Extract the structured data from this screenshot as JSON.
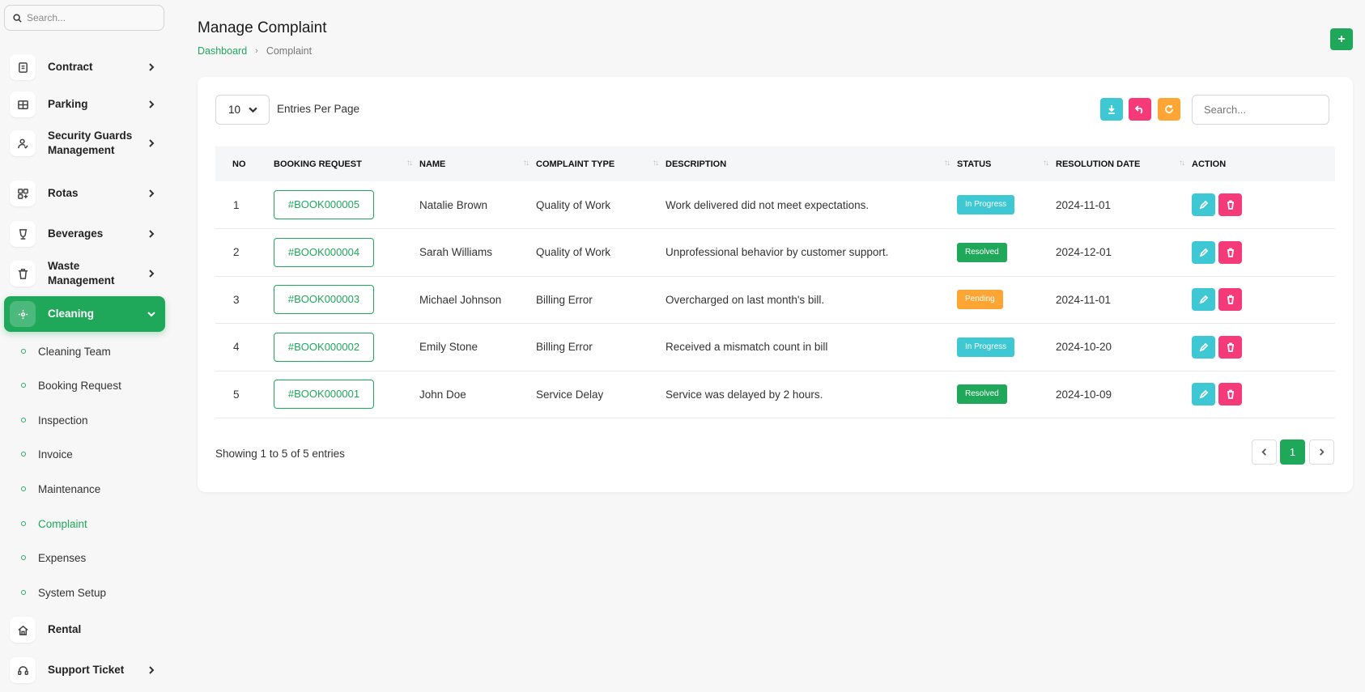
{
  "sidebar": {
    "search_placeholder": "Search...",
    "items": [
      {
        "label": "Contract",
        "icon": "contract-icon"
      },
      {
        "label": "Parking",
        "icon": "parking-icon"
      },
      {
        "label": "Security Guards Management",
        "icon": "security-guard-icon"
      },
      {
        "label": "Rotas",
        "icon": "rotas-icon"
      },
      {
        "label": "Beverages",
        "icon": "beverages-icon"
      },
      {
        "label": "Waste Management",
        "icon": "trash-icon"
      },
      {
        "label": "Cleaning",
        "icon": "sparkle-icon",
        "active": true
      }
    ],
    "sub_items": [
      {
        "label": "Cleaning Team"
      },
      {
        "label": "Booking Request"
      },
      {
        "label": "Inspection"
      },
      {
        "label": "Invoice"
      },
      {
        "label": "Maintenance"
      },
      {
        "label": "Complaint",
        "active": true
      },
      {
        "label": "Expenses"
      },
      {
        "label": "System Setup"
      }
    ],
    "bottom_items": [
      {
        "label": "Rental",
        "icon": "home-icon"
      },
      {
        "label": "Support Ticket",
        "icon": "headset-icon"
      }
    ]
  },
  "header": {
    "title": "Manage Complaint",
    "breadcrumb": [
      "Dashboard",
      "Complaint"
    ],
    "add_label": "+"
  },
  "table_controls": {
    "per_page_value": "10",
    "per_page_label": "Entries Per Page",
    "search_placeholder": "Search..."
  },
  "table": {
    "columns": [
      "NO",
      "BOOKING REQUEST",
      "NAME",
      "COMPLAINT TYPE",
      "DESCRIPTION",
      "STATUS",
      "RESOLUTION DATE",
      "ACTION"
    ],
    "rows": [
      {
        "no": "1",
        "booking": "#BOOK000005",
        "name": "Natalie Brown",
        "type": "Quality of Work",
        "description": "Work delivered did not meet expectations.",
        "status": "In Progress",
        "date": "2024-11-01"
      },
      {
        "no": "2",
        "booking": "#BOOK000004",
        "name": "Sarah Williams",
        "type": "Quality of Work",
        "description": "Unprofessional behavior by customer support.",
        "status": "Resolved",
        "date": "2024-12-01"
      },
      {
        "no": "3",
        "booking": "#BOOK000003",
        "name": "Michael Johnson",
        "type": "Billing Error",
        "description": "Overcharged on last month's bill.",
        "status": "Pending",
        "date": "2024-11-01"
      },
      {
        "no": "4",
        "booking": "#BOOK000002",
        "name": "Emily Stone",
        "type": "Billing Error",
        "description": "Received a mismatch count in bill",
        "status": "In Progress",
        "date": "2024-10-20"
      },
      {
        "no": "5",
        "booking": "#BOOK000001",
        "name": "John Doe",
        "type": "Service Delay",
        "description": "Service was delayed by 2 hours.",
        "status": "Resolved",
        "date": "2024-10-09"
      }
    ]
  },
  "footer": {
    "showing": "Showing 1 to 5 of 5 entries",
    "current_page": "1"
  },
  "colors": {
    "primary": "#1fa85a",
    "info": "#3ec8d4",
    "danger": "#f53a7a",
    "warning": "#ffa534"
  }
}
